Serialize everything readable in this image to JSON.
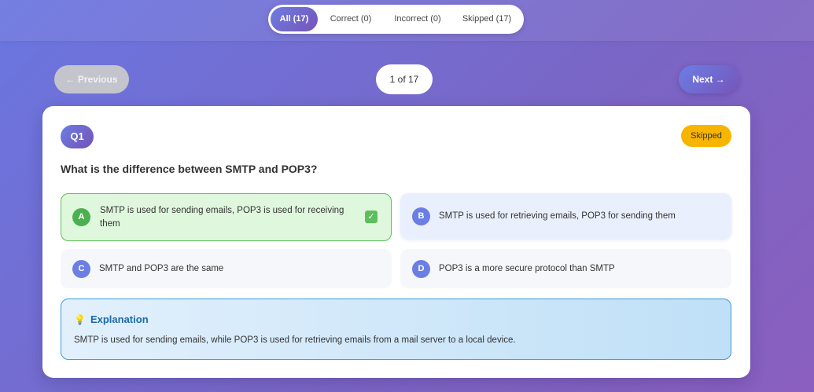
{
  "filters": [
    {
      "label": "All (17)",
      "active": true
    },
    {
      "label": "Correct (0)",
      "active": false
    },
    {
      "label": "Incorrect (0)",
      "active": false
    },
    {
      "label": "Skipped (17)",
      "active": false
    }
  ],
  "nav": {
    "prev_label": "← Previous",
    "next_label": "Next →",
    "page_indicator": "1 of 17"
  },
  "question": {
    "number": "Q1",
    "status": "Skipped",
    "text": "What is the difference between SMTP and POP3?",
    "options": [
      {
        "letter": "A",
        "text": "SMTP is used for sending emails, POP3 is used for receiving them",
        "state": "correct"
      },
      {
        "letter": "B",
        "text": "SMTP is used for retrieving emails, POP3 for sending them",
        "state": "highlighted"
      },
      {
        "letter": "C",
        "text": "SMTP and POP3 are the same",
        "state": "normal"
      },
      {
        "letter": "D",
        "text": "POP3 is a more secure protocol than SMTP",
        "state": "normal"
      }
    ],
    "check_icon": "✓"
  },
  "explanation": {
    "icon": "lightbulb-icon",
    "icon_glyph": "💡",
    "title": "Explanation",
    "text": "SMTP is used for sending emails, while POP3 is used for retrieving emails from a mail server to a local device."
  },
  "colors": {
    "accent": "#6b7ee4",
    "accent_dark": "#7551b6",
    "correct": "#4caf50",
    "skipped": "#f7b500",
    "explanation_border": "#3b9ad6"
  }
}
